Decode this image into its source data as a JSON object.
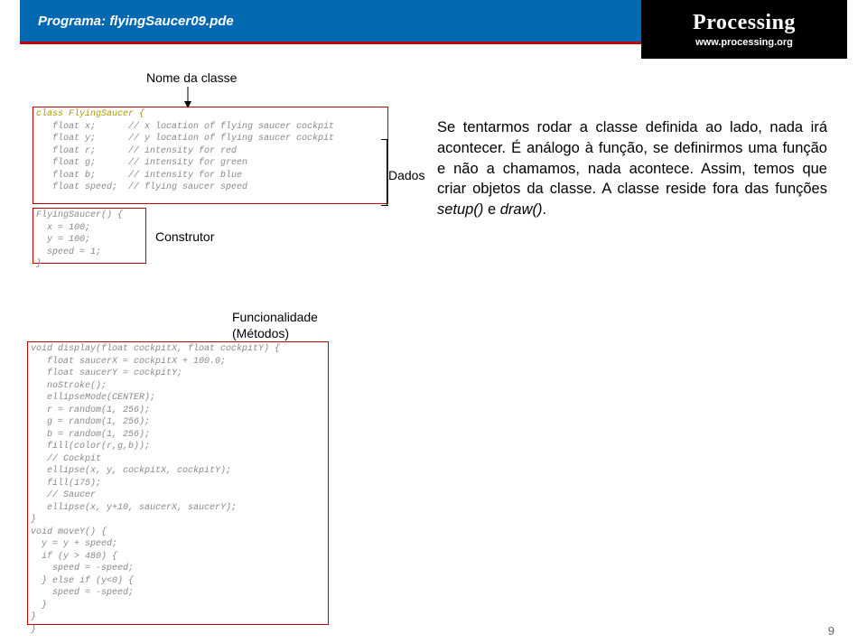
{
  "header": {
    "title": "Programa: flyingSaucer09.pde"
  },
  "logo": {
    "name": "Processing",
    "url": "www.processing.org"
  },
  "labels": {
    "nome": "Nome da classe",
    "construtor": "Construtor",
    "dados": "Dados",
    "func1": "Funcionalidade",
    "func2": "(Métodos)"
  },
  "code": {
    "classLine": "class FlyingSaucer {",
    "block1": "   float x;      // x location of flying saucer cockpit\n   float y;      // y location of flying saucer cockpit\n   float r;      // intensity for red\n   float g;      // intensity for green\n   float b;      // intensity for blue\n   float speed;  // flying saucer speed",
    "block2": "FlyingSaucer() {\n  x = 100;\n  y = 100;\n  speed = 1;\n}",
    "block3": "void display(float cockpitX, float cockpitY) {\n   float saucerX = cockpitX + 100.0;\n   float saucerY = cockpitY;\n   noStroke();\n   ellipseMode(CENTER);\n   r = random(1, 256);\n   g = random(1, 256);\n   b = random(1, 256);\n   fill(color(r,g,b));\n   // Cockpit\n   ellipse(x, y, cockpitX, cockpitY);\n   fill(175);\n   // Saucer\n   ellipse(x, y+10, saucerX, saucerY);\n}\nvoid moveY() {\n  y = y + speed;\n  if (y > 480) {\n    speed = -speed;\n  } else if (y<0) {\n    speed = -speed;\n  }\n}\n}"
  },
  "explain": {
    "p": "Se tentarmos rodar a classe definida ao lado, nada irá acontecer. É análogo à função, se definirmos uma função e não a chamamos, nada acontece. Assim, temos que criar objetos da classe. A classe reside fora das funções ",
    "s1": "setup()",
    "and": " e ",
    "s2": "draw()",
    "end": "."
  },
  "pageNum": "9"
}
